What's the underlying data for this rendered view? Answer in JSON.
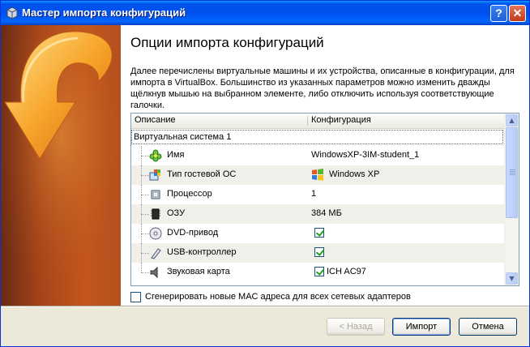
{
  "window": {
    "title": "Мастер импорта конфигураций",
    "help_button": "?",
    "close_button": "✕"
  },
  "page": {
    "heading": "Опции импорта конфигураций",
    "description": "Далее перечислены виртуальные машины и их устройства, описанные в конфигурации, для импорта в VirtualBox. Большинство из указанных параметров можно изменить дважды щёлкнув мышью на выбранном элементе, либо отключить используя соответствующие галочки."
  },
  "table": {
    "columns": [
      "Описание",
      "Конфигурация"
    ],
    "group": "Виртуальная система 1",
    "rows": [
      {
        "icon": "name-icon",
        "name": "Имя",
        "value": "WindowsXP-3IM-student_1"
      },
      {
        "icon": "os-type-icon",
        "name": "Тип гостевой ОС",
        "value": "Windows XP"
      },
      {
        "icon": "cpu-icon",
        "name": "Процессор",
        "value": "1"
      },
      {
        "icon": "ram-icon",
        "name": "ОЗУ",
        "value": "384 МБ"
      },
      {
        "icon": "dvd-icon",
        "name": "DVD-привод",
        "value": "",
        "checked": true
      },
      {
        "icon": "usb-icon",
        "name": "USB-контроллер",
        "value": "",
        "checked": true
      },
      {
        "icon": "sound-icon",
        "name": "Звуковая карта",
        "value": "ICH AC97",
        "checked": true
      }
    ]
  },
  "options": {
    "mac_label": "Сгенерировать новые MAC адреса для всех сетевых адаптеров",
    "mac_checked": false
  },
  "buttons": {
    "back": "< Назад",
    "import": "Импорт",
    "cancel": "Отмена"
  },
  "colors": {
    "titlebar": "#0053ee",
    "side_panel": "#b5501e",
    "check": "#21a121"
  }
}
